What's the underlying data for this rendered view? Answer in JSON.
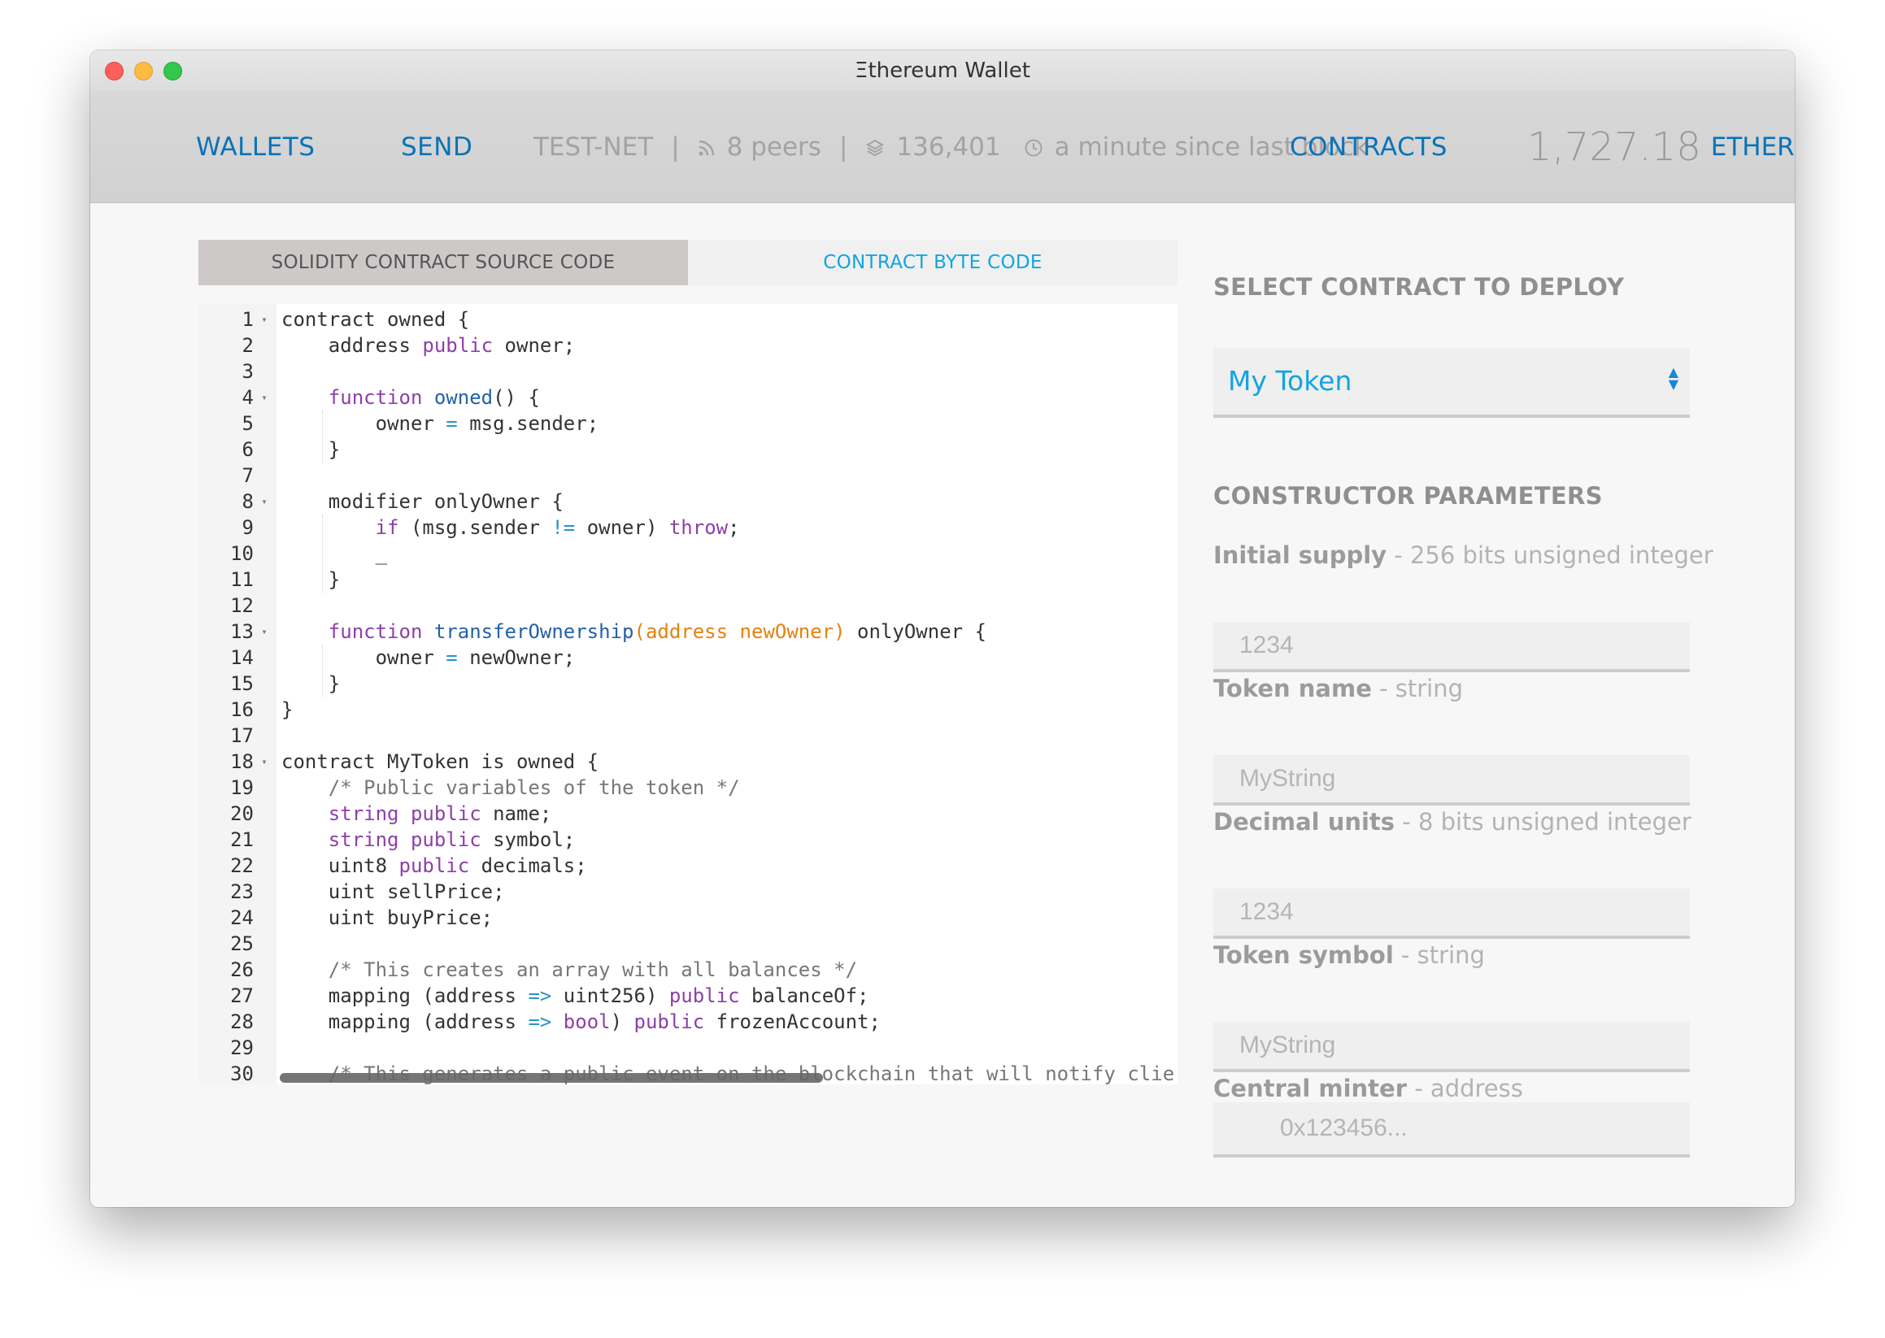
{
  "window": {
    "title": "Ξthereum Wallet"
  },
  "nav": {
    "wallets": "WALLETS",
    "send": "SEND",
    "contracts": "CONTRACTS"
  },
  "status": {
    "network": "TEST-NET",
    "peers": "8 peers",
    "block": "136,401",
    "last_block": "a minute since last block"
  },
  "balance": {
    "amount": "1,727.18",
    "unit": "ETHER"
  },
  "tabs": {
    "source": "SOLIDITY CONTRACT SOURCE CODE",
    "bytecode": "CONTRACT BYTE CODE"
  },
  "editor": {
    "line_numbers": [
      "1",
      "2",
      "3",
      "4",
      "5",
      "6",
      "7",
      "8",
      "9",
      "10",
      "11",
      "12",
      "13",
      "14",
      "15",
      "16",
      "17",
      "18",
      "19",
      "20",
      "21",
      "22",
      "23",
      "24",
      "25",
      "26",
      "27",
      "28",
      "29",
      "30"
    ],
    "lines": [
      "contract owned {",
      "    address public owner;",
      "",
      "    function owned() {",
      "        owner = msg.sender;",
      "    }",
      "",
      "    modifier onlyOwner {",
      "        if (msg.sender != owner) throw;",
      "        _",
      "    }",
      "",
      "    function transferOwnership(address newOwner) onlyOwner {",
      "        owner = newOwner;",
      "    }",
      "}",
      "",
      "contract MyToken is owned {",
      "    /* Public variables of the token */",
      "    string public name;",
      "    string public symbol;",
      "    uint8 public decimals;",
      "    uint sellPrice;",
      "    uint buyPrice;",
      "",
      "    /* This creates an array with all balances */",
      "    mapping (address => uint256) public balanceOf;",
      "    mapping (address => bool) public frozenAccount;",
      "",
      "    /* This generates a public event on the blockchain that will notify clier"
    ]
  },
  "deploy": {
    "heading": "SELECT CONTRACT TO DEPLOY",
    "selected": "My Token"
  },
  "constructor": {
    "heading": "CONSTRUCTOR PARAMETERS",
    "params": [
      {
        "name": "Initial supply",
        "type": " - 256 bits unsigned integer",
        "placeholder": "1234"
      },
      {
        "name": "Token name",
        "type": " - string",
        "placeholder": "MyString"
      },
      {
        "name": "Decimal units",
        "type": " - 8 bits unsigned integer",
        "placeholder": "1234"
      },
      {
        "name": "Token symbol",
        "type": " - string",
        "placeholder": "MyString"
      },
      {
        "name": "Central minter",
        "type": " - address",
        "placeholder": "0x123456..."
      }
    ]
  },
  "colors": {
    "nav_link": "#0a73b8",
    "accent": "#12a4e0",
    "keyword": "#8e3fa8",
    "function": "#2361a8",
    "parameter": "#e4820d"
  }
}
